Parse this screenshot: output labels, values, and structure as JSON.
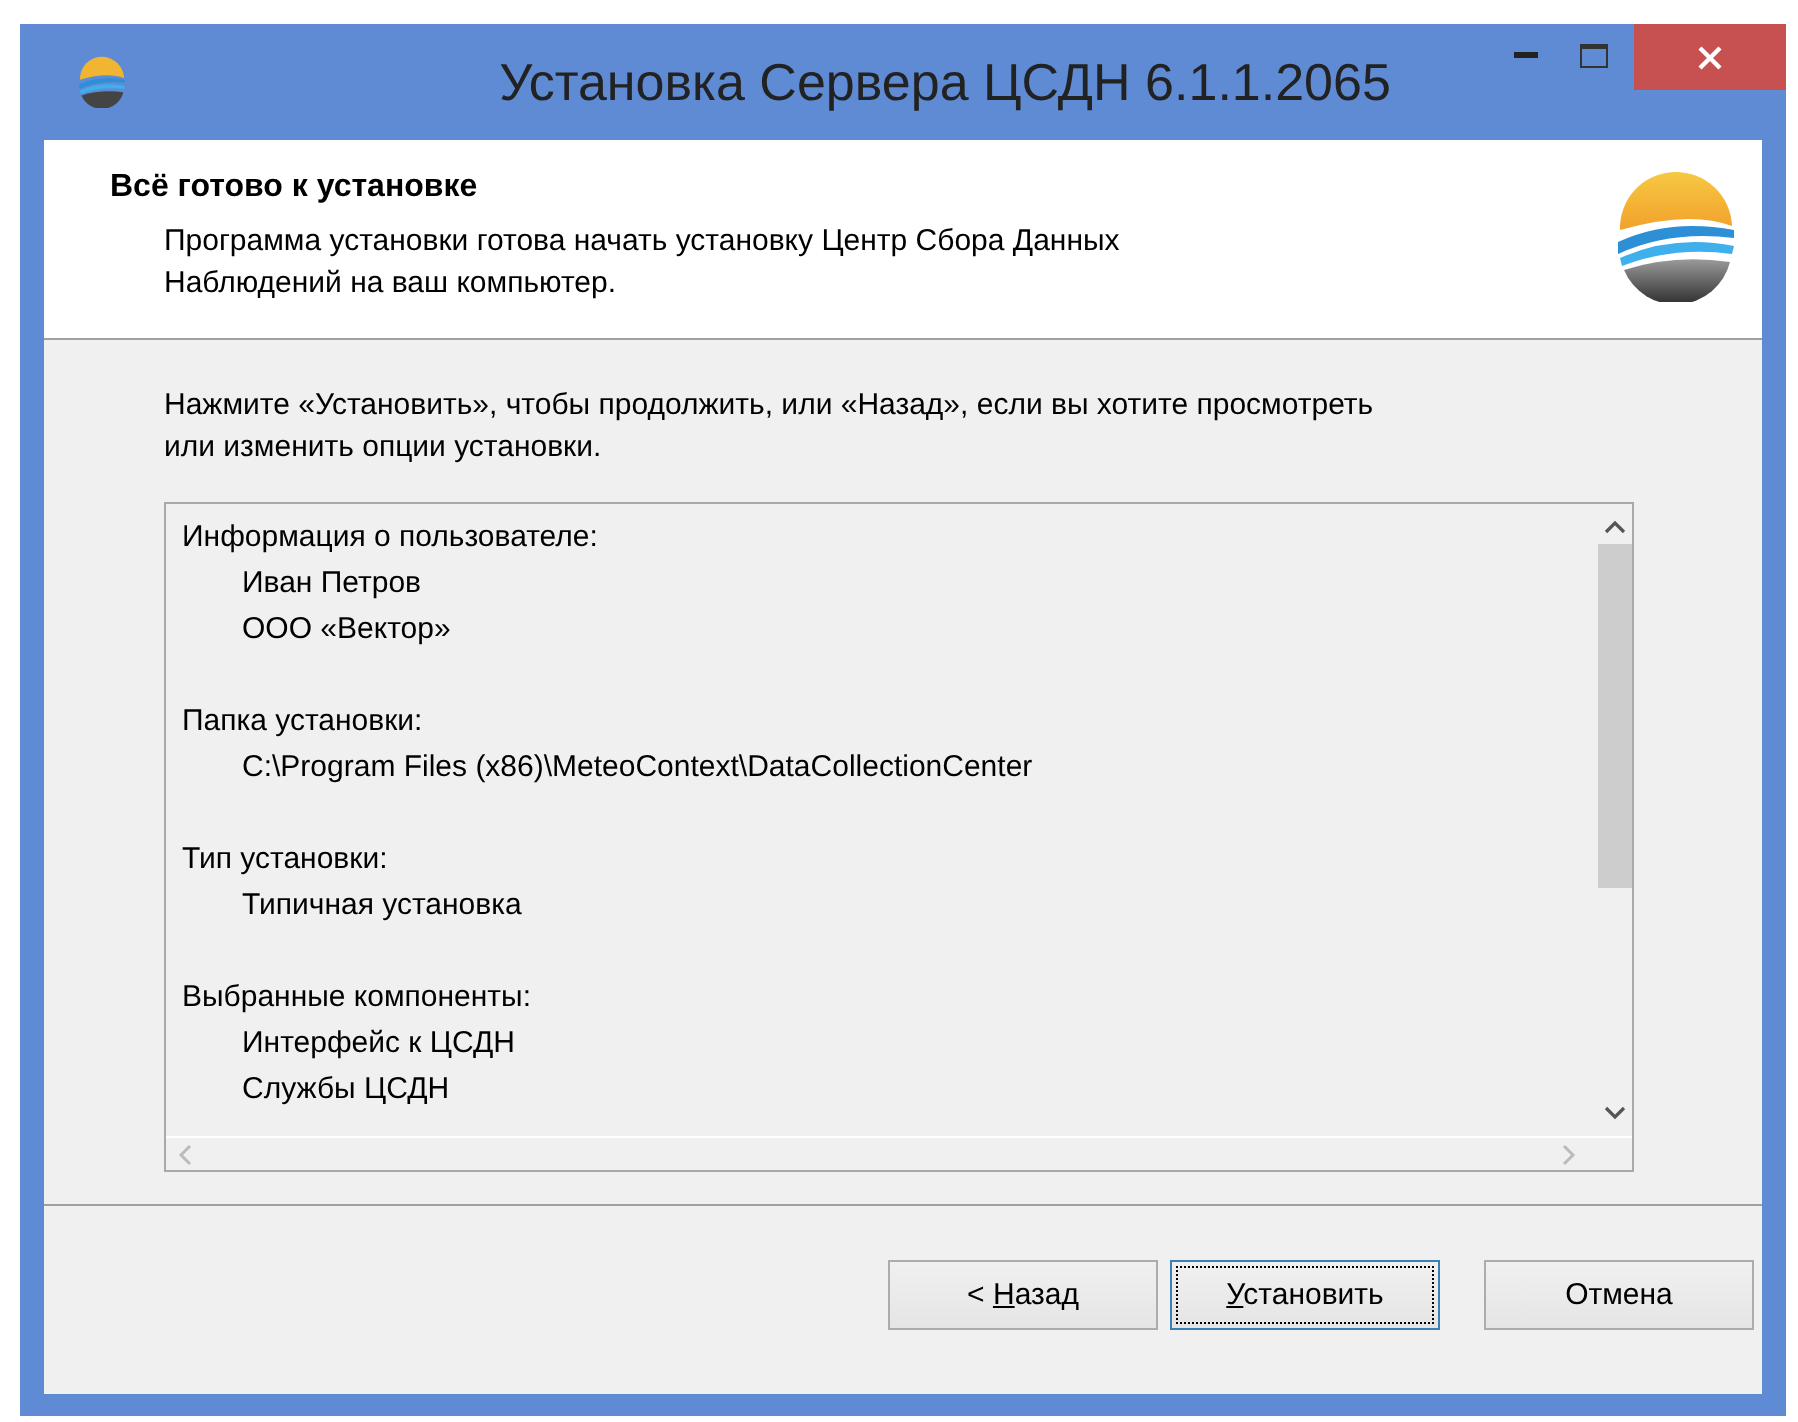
{
  "window": {
    "title": "Установка Сервера ЦСДН 6.1.1.2065"
  },
  "header": {
    "title": "Всё готово к установке",
    "subtitle": "Программа установки готова начать установку Центр Сбора Данных Наблюдений на ваш компьютер."
  },
  "instruction": "Нажмите «Установить», чтобы продолжить, или «Назад», если вы хотите просмотреть или изменить опции установки.",
  "summary": [
    {
      "heading": "Информация о пользователе:",
      "items": [
        "Иван Петров",
        "ООО «Вектор»"
      ]
    },
    {
      "heading": "Папка установки:",
      "items": [
        "C:\\Program Files (x86)\\MeteoContext\\DataCollectionCenter"
      ]
    },
    {
      "heading": "Тип установки:",
      "items": [
        "Типичная установка"
      ]
    },
    {
      "heading": "Выбранные компоненты:",
      "items": [
        "Интерфейс к ЦСДН",
        "Службы ЦСДН"
      ]
    }
  ],
  "buttons": [
    {
      "before": "< ",
      "key": "Н",
      "after": "азад",
      "focused": false
    },
    {
      "key": "У",
      "after": "становить",
      "focused": true
    },
    {
      "after": "Отмена",
      "focused": false
    }
  ]
}
